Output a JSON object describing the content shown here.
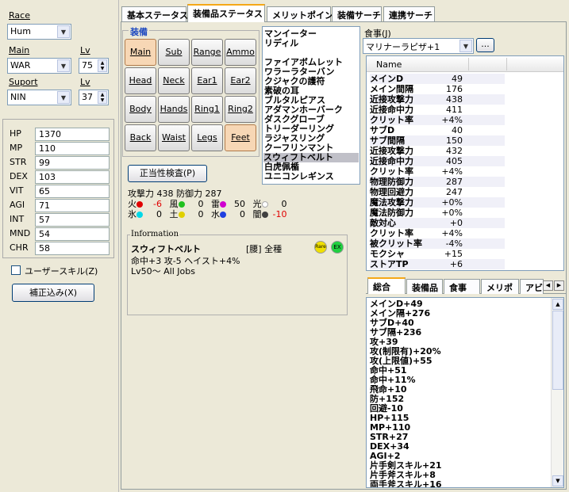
{
  "left": {
    "race_label": "Race",
    "race_value": "Hum",
    "main_label": "Main",
    "main_value": "WAR",
    "main_lv_label": "Lv",
    "main_lv": "75",
    "support_label": "Suport",
    "support_value": "NIN",
    "support_lv_label": "Lv",
    "support_lv": "37",
    "stats": [
      {
        "k": "HP",
        "v": "1370"
      },
      {
        "k": "MP",
        "v": "110"
      },
      {
        "k": "STR",
        "v": "99"
      },
      {
        "k": "DEX",
        "v": "103"
      },
      {
        "k": "VIT",
        "v": "65"
      },
      {
        "k": "AGI",
        "v": "71"
      },
      {
        "k": "INT",
        "v": "57"
      },
      {
        "k": "MND",
        "v": "54"
      },
      {
        "k": "CHR",
        "v": "58"
      }
    ],
    "user_skill_label": "ユーザースキル(Z)",
    "correction_button": "補正込み(X)"
  },
  "tabs": [
    "基本ステータス",
    "装備品ステータス",
    "メリットポイント",
    "装備サーチ",
    "連携サーチ"
  ],
  "equip": {
    "group_label": "装備",
    "slots": [
      "Main",
      "Sub",
      "Range",
      "Ammo",
      "Head",
      "Neck",
      "Ear1",
      "Ear2",
      "Body",
      "Hands",
      "Ring1",
      "Ring2",
      "Back",
      "Waist",
      "Legs",
      "Feet"
    ],
    "validity_button": "正当性検査(P)",
    "atk_line": "攻撃力 438 防御力 287",
    "elements": [
      {
        "name": "火",
        "color": "#e00000",
        "value": "-6",
        "neg": true
      },
      {
        "name": "風",
        "color": "#20c020",
        "value": "0",
        "neg": false
      },
      {
        "name": "雷",
        "color": "#d000d0",
        "value": "50",
        "neg": false
      },
      {
        "name": "光",
        "color": "#ffffff",
        "value": "0",
        "neg": false
      },
      {
        "name": "氷",
        "color": "#00d8e8",
        "value": "0",
        "neg": false
      },
      {
        "name": "土",
        "color": "#e0d000",
        "value": "0",
        "neg": false
      },
      {
        "name": "水",
        "color": "#2040e0",
        "value": "0",
        "neg": false
      },
      {
        "name": "闇",
        "color": "#404040",
        "value": "-10",
        "neg": true
      }
    ]
  },
  "item_list": [
    "マンイーター",
    "リディル",
    "",
    "ファイアボムレット",
    "ワラーラターバン",
    "クジャクの護符",
    "素破の耳",
    "ブルタルピアス",
    "アダマンホーバーク",
    "ダスクグローブ",
    "トリーダーリング",
    "ラジャスリング",
    "クーフリンマント",
    "スウィフトベルト",
    "白虎佩楯",
    "ユニコンレギンス"
  ],
  "info": {
    "legend": "Information",
    "name": "スウィフトベルト",
    "slot": "[腰] 全種",
    "badge1": "Rare",
    "badge2": "EX",
    "line1": "命中+3 攻-5 ヘイスト+4%",
    "line2": "Lv50〜 All Jobs"
  },
  "food": {
    "label": "食事(J)",
    "value": "マリナーラピザ+1",
    "more_button": "..."
  },
  "status_header": "Name",
  "status_rows": [
    {
      "k": "メインD",
      "v": "49"
    },
    {
      "k": "メイン間隔",
      "v": "176"
    },
    {
      "k": "近接攻撃力",
      "v": "438"
    },
    {
      "k": "近接命中力",
      "v": "411"
    },
    {
      "k": "クリット率",
      "v": "+4%"
    },
    {
      "k": "サブD",
      "v": "40"
    },
    {
      "k": "サブ間隔",
      "v": "150"
    },
    {
      "k": "近接攻撃力",
      "v": "432"
    },
    {
      "k": "近接命中力",
      "v": "405"
    },
    {
      "k": "クリット率",
      "v": "+4%"
    },
    {
      "k": "物理防御力",
      "v": "287"
    },
    {
      "k": "物理回避力",
      "v": "247"
    },
    {
      "k": "魔法攻撃力",
      "v": "+0%"
    },
    {
      "k": "魔法防御力",
      "v": "+0%"
    },
    {
      "k": "敵対心",
      "v": "+0"
    },
    {
      "k": "クリット率",
      "v": "+4%"
    },
    {
      "k": "被クリット率",
      "v": "-4%"
    },
    {
      "k": "モクシャ",
      "v": "+15"
    },
    {
      "k": "ストアTP",
      "v": "+6"
    }
  ],
  "bottom_tabs": [
    "総合",
    "装備品",
    "食事",
    "メリポ",
    "アビ"
  ],
  "totals": [
    "メインD+49",
    "メイン隔+276",
    "サブD+40",
    "サブ隔+236",
    "攻+39",
    "攻(制限有)+20%",
    "攻(上限値)+55",
    "命中+51",
    "命中+11%",
    "飛命+10",
    "防+152",
    "回避-10",
    "HP+115",
    "MP+110",
    "STR+27",
    "DEX+34",
    "AGI+2",
    "片手剣スキル+21",
    "片手斧スキル+8",
    "両手斧スキル+16"
  ]
}
